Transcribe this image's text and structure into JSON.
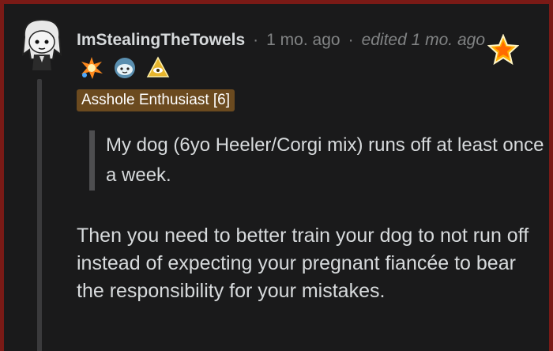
{
  "comment": {
    "author": "ImStealingTheTowels",
    "separator": "·",
    "time": "1 mo. ago",
    "edited": "edited 1 mo. ago",
    "flair": "Asshole Enthusiast [6]",
    "quote": "My dog (6yo Heeler/Corgi mix) runs off at least once a week.",
    "body": "Then you need to better train your dog to not run off instead of expecting your pregnant fiancée to bear the responsibility for your mistakes."
  },
  "awards": [
    {
      "icon": "starburst-award-icon"
    },
    {
      "icon": "cloud-face-award-icon"
    },
    {
      "icon": "golden-eye-award-icon"
    }
  ],
  "theme": {
    "background": "#1a1a1b",
    "frame": "#7a1a16",
    "text": "#d7dadc",
    "muted": "#818384",
    "flair_bg": "#6b4a1f"
  }
}
